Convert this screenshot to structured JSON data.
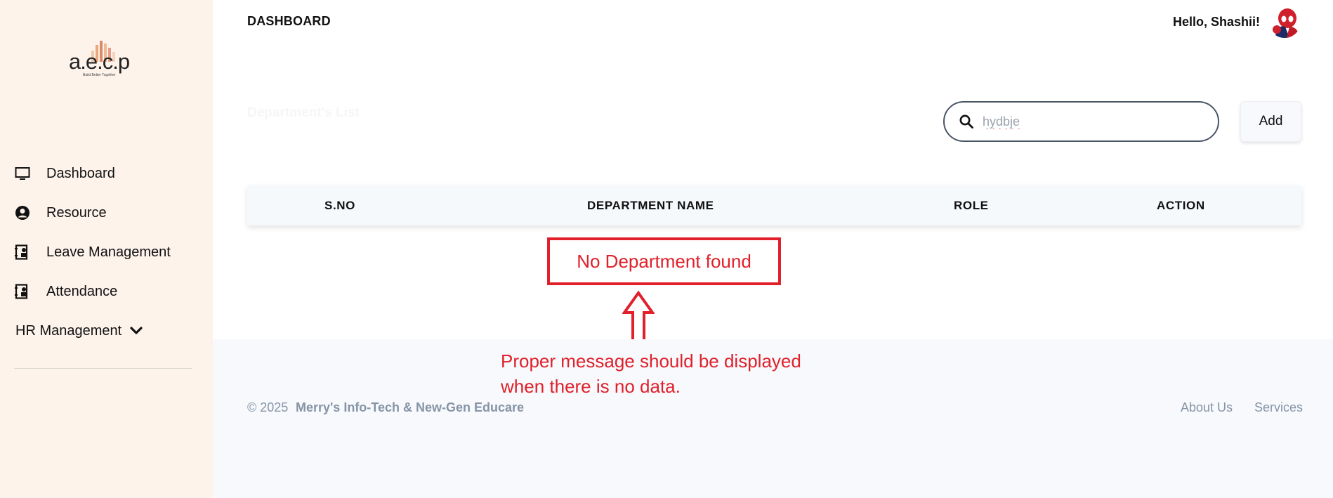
{
  "sidebar": {
    "logo": {
      "text": "a.e.c.p",
      "tagline": "Build Better Together"
    },
    "items": [
      {
        "label": "Dashboard",
        "icon": "monitor-icon"
      },
      {
        "label": "Resource",
        "icon": "user-circle-icon"
      },
      {
        "label": "Leave Management",
        "icon": "contact-book-icon"
      },
      {
        "label": "Attendance",
        "icon": "contact-book-icon"
      },
      {
        "label": "HR Management",
        "icon": "chevron-down-icon"
      }
    ]
  },
  "header": {
    "title": "DASHBOARD",
    "greeting": "Hello, Shashii!"
  },
  "main": {
    "list_title": "Department's List",
    "search": {
      "value": "hydbje",
      "placeholder": ""
    },
    "add_label": "Add",
    "table": {
      "columns": [
        "S.NO",
        "DEPARTMENT NAME",
        "ROLE",
        "ACTION"
      ],
      "rows": [],
      "empty_message": "No Department found"
    }
  },
  "annotation": {
    "note_line1": "Proper message should be displayed",
    "note_line2": "when there is no data.",
    "color": "#e0202a"
  },
  "footer": {
    "copyright": "© 2025",
    "company": "Merry's Info-Tech & New-Gen Educare",
    "links": [
      "About Us",
      "Services"
    ]
  },
  "colors": {
    "sidebar_bg": "#fdf3eb",
    "footer_bg": "#f7f9fc",
    "muted_text": "#8694a6"
  }
}
